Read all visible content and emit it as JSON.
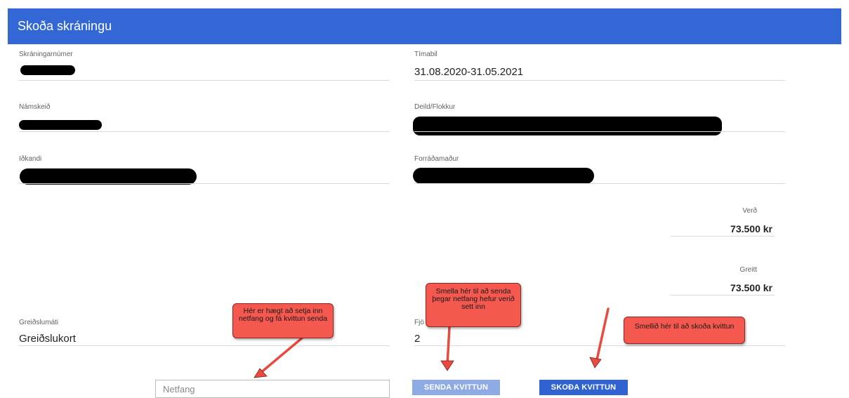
{
  "header": {
    "title": "Skoða skráningu"
  },
  "fields": {
    "registration_number": {
      "label": "Skráningarnúmer",
      "value": ""
    },
    "period": {
      "label": "Tímabil",
      "value": "31.08.2020-31.05.2021"
    },
    "course": {
      "label": "Námskeið",
      "value": ""
    },
    "department": {
      "label": "Deild/Flokkur",
      "value": ""
    },
    "participant": {
      "label": "Iðkandi",
      "value": ""
    },
    "guardian": {
      "label": "Forráðamaður",
      "value": ""
    },
    "payment_method": {
      "label": "Greiðslumáti",
      "value": "Greiðslukort"
    },
    "installments": {
      "label": "Fjö",
      "value": "2"
    }
  },
  "price": {
    "label": "Verð",
    "value": "73.500 kr"
  },
  "paid": {
    "label": "Greitt",
    "value": "73.500 kr"
  },
  "email": {
    "placeholder": "Netfang",
    "value": ""
  },
  "buttons": {
    "send": "SENDA KVITTUN",
    "view": "SKOÐA KVITTUN"
  },
  "annotations": {
    "email_note": "Hér er hægt að setja inn netfang og fá kvittun senda",
    "send_note": "Smella hér til að senda þegar netfang hefur verið sett inn",
    "view_note": "Smellið hér til að skoða kvittun"
  },
  "colors": {
    "header": "#3367d6",
    "send_button": "#8eabe6",
    "view_button": "#2f63d1",
    "note": "#f4584f"
  }
}
